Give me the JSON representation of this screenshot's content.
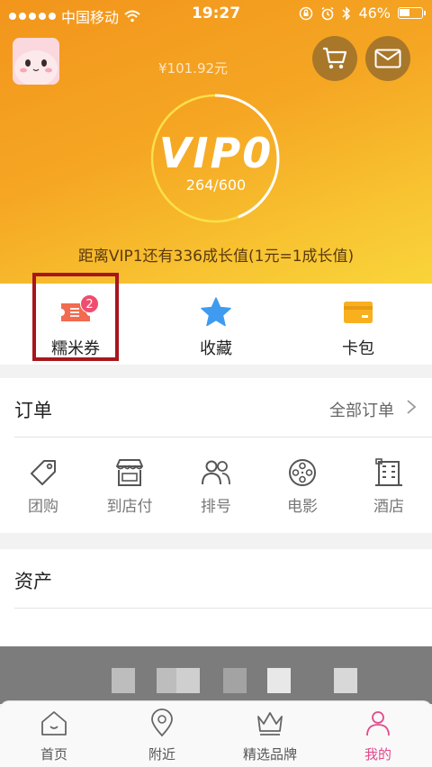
{
  "status_bar": {
    "carrier": "中国移动",
    "time": "19:27",
    "battery": "46%"
  },
  "header": {
    "balance": "¥101.92元",
    "vip_level": "VIP0",
    "vip_progress": "264/600",
    "vip_progress_fraction": 0.44,
    "vip_hint": "距离VIP1还有336成长值(1元=1成长值)"
  },
  "quick_actions": [
    {
      "label": "糯米券",
      "icon": "coupon-icon",
      "badge": "2"
    },
    {
      "label": "收藏",
      "icon": "star-icon"
    },
    {
      "label": "卡包",
      "icon": "card-wallet-icon"
    }
  ],
  "orders": {
    "title": "订单",
    "all_label": "全部订单",
    "items": [
      {
        "label": "团购",
        "icon": "tag-icon"
      },
      {
        "label": "到店付",
        "icon": "store-icon"
      },
      {
        "label": "排号",
        "icon": "people-icon"
      },
      {
        "label": "电影",
        "icon": "film-reel-icon"
      },
      {
        "label": "酒店",
        "icon": "hotel-icon"
      }
    ]
  },
  "assets": {
    "title": "资产"
  },
  "tabbar": [
    {
      "label": "首页",
      "icon": "home-icon"
    },
    {
      "label": "附近",
      "icon": "location-pin-icon"
    },
    {
      "label": "精选品牌",
      "icon": "crown-icon"
    },
    {
      "label": "我的",
      "icon": "user-icon",
      "active": true
    }
  ],
  "colors": {
    "accent": "#f5a623",
    "highlight_box": "#a8161d",
    "active_tab": "#e2498a",
    "badge": "#ef4d6e"
  }
}
